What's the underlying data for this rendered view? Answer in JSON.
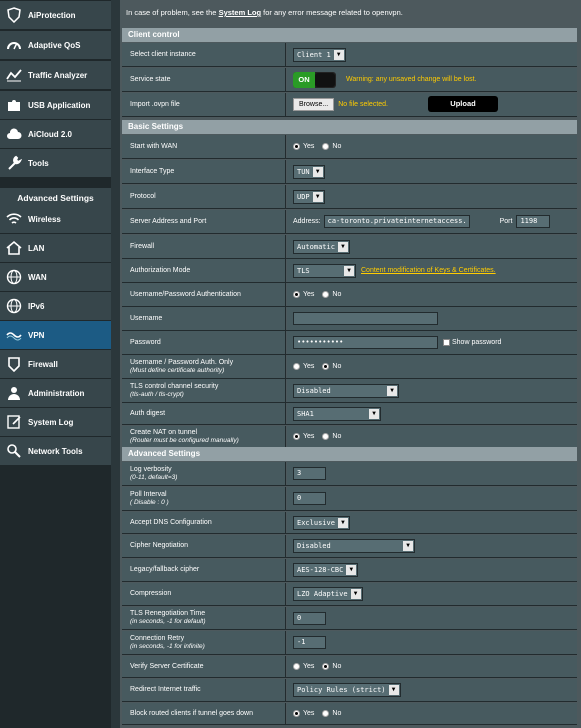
{
  "sidebar": {
    "items": [
      {
        "label": "AiProtection",
        "icon": "shield-icon"
      },
      {
        "label": "Adaptive QoS",
        "icon": "speedometer-icon"
      },
      {
        "label": "Traffic Analyzer",
        "icon": "chart-icon"
      },
      {
        "label": "USB Application",
        "icon": "puzzle-icon"
      },
      {
        "label": "AiCloud 2.0",
        "icon": "cloud-icon"
      },
      {
        "label": "Tools",
        "icon": "wrench-icon"
      }
    ],
    "advanced_header": "Advanced Settings",
    "advanced_items": [
      {
        "label": "Wireless",
        "icon": "wifi-icon"
      },
      {
        "label": "LAN",
        "icon": "home-icon"
      },
      {
        "label": "WAN",
        "icon": "globe-icon"
      },
      {
        "label": "IPv6",
        "icon": "globe-icon"
      },
      {
        "label": "VPN",
        "icon": "vpn-icon"
      },
      {
        "label": "Firewall",
        "icon": "firewall-icon"
      },
      {
        "label": "Administration",
        "icon": "person-icon"
      },
      {
        "label": "System Log",
        "icon": "log-icon"
      },
      {
        "label": "Network Tools",
        "icon": "network-icon"
      }
    ]
  },
  "top_note": {
    "before": "In case of problem, see the ",
    "link": "System Log",
    "after": " for any error message related to openvpn."
  },
  "client_control": {
    "title": "Client control",
    "select_instance_label": "Select client instance",
    "select_instance_value": "Client 1",
    "service_state_label": "Service state",
    "toggle_on": "ON",
    "warning": "Warning: any unsaved change will be lost.",
    "import_label": "Import .ovpn file",
    "browse": "Browse...",
    "no_file": "No file selected.",
    "upload": "Upload"
  },
  "basic": {
    "title": "Basic Settings",
    "start_wan_label": "Start with WAN",
    "interface_label": "Interface Type",
    "interface_value": "TUN",
    "protocol_label": "Protocol",
    "protocol_value": "UDP",
    "server_label": "Server Address and Port",
    "address_label": "Address:",
    "address_value": "ca-toronto.privateinternetaccess.",
    "port_label": "Port",
    "port_value": "1198",
    "firewall_label": "Firewall",
    "firewall_value": "Automatic",
    "auth_mode_label": "Authorization Mode",
    "auth_mode_value": "TLS",
    "auth_mode_link": "Content modification of Keys & Certificates.",
    "userpass_label": "Username/Password Authentication",
    "username_label": "Username",
    "username_value": "",
    "password_label": "Password",
    "password_value": "•••••••••••",
    "show_password": "Show password",
    "auth_only_label": "Username / Password Auth. Only",
    "auth_only_note": "(Must define certificate authority)",
    "tls_label": "TLS control channel security",
    "tls_note": "(tls-auth / tls-crypt)",
    "tls_value": "Disabled",
    "digest_label": "Auth digest",
    "digest_value": "SHA1",
    "nat_label": "Create NAT on tunnel",
    "nat_note": "(Router must be configured manually)"
  },
  "advanced": {
    "title": "Advanced Settings",
    "verbosity_label": "Log verbosity",
    "verbosity_note": "(0-11, default=3)",
    "verbosity_value": "3",
    "poll_label": "Poll Interval",
    "poll_note": "( Disable : 0 )",
    "poll_value": "0",
    "dns_label": "Accept DNS Configuration",
    "dns_value": "Exclusive",
    "cipher_neg_label": "Cipher Negotiation",
    "cipher_neg_value": "Disabled",
    "legacy_label": "Legacy/fallback cipher",
    "legacy_value": "AES-128-CBC",
    "compression_label": "Compression",
    "compression_value": "LZO Adaptive",
    "reneg_label": "TLS Renegotiation Time",
    "reneg_note": "(in seconds, -1 for default)",
    "reneg_value": "0",
    "retry_label": "Connection Retry",
    "retry_note": "(in seconds, -1 for infinite)",
    "retry_value": "-1",
    "verify_label": "Verify Server Certificate",
    "redirect_label": "Redirect Internet traffic",
    "redirect_value": "Policy Rules (strict)",
    "block_label": "Block routed clients if tunnel goes down"
  },
  "radio": {
    "yes": "Yes",
    "no": "No"
  }
}
